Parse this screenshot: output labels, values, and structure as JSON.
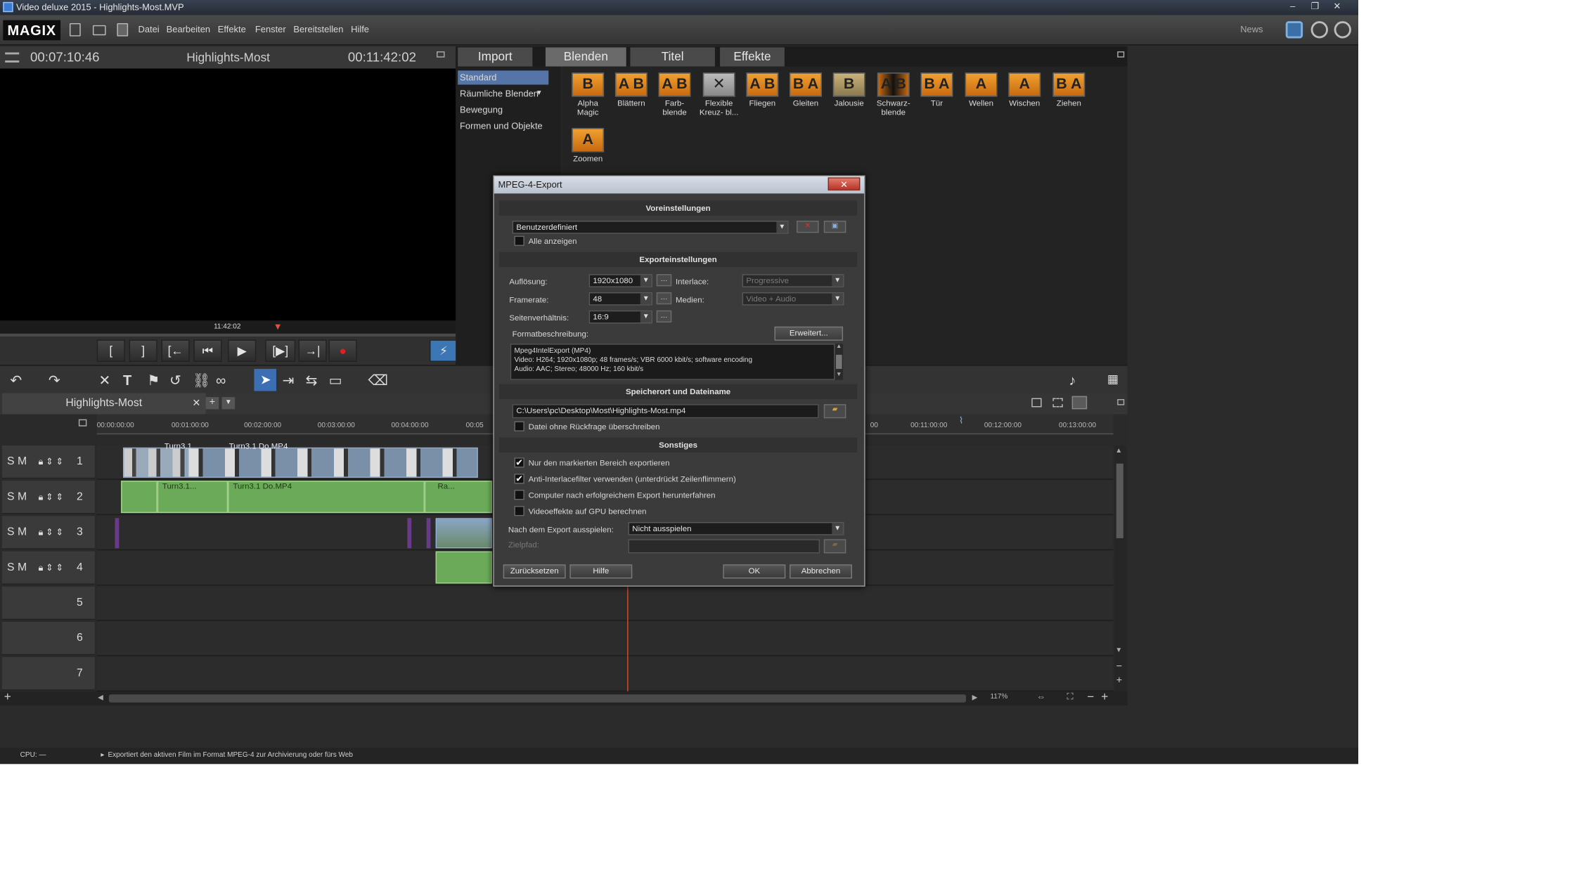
{
  "window": {
    "title": "Video deluxe 2015 - Highlights-Most.MVP",
    "controls": [
      "–",
      "❐",
      "✕"
    ]
  },
  "menubar": {
    "logo": "MAGIX",
    "menus": [
      "Datei",
      "Bearbeiten",
      "Effekte",
      "Fenster",
      "Bereitstellen",
      "Hilfe"
    ],
    "news": "News"
  },
  "preview": {
    "time_left": "00:07:10:46",
    "title": "Highlights-Most",
    "time_right": "00:11:42:02",
    "scrub_time": "11:42:02",
    "transport": [
      "[",
      "]",
      "[←",
      "⏮",
      "▶",
      "[▶]",
      "→|",
      "●",
      "⚡"
    ]
  },
  "mediapool": {
    "tabs": [
      "Import",
      "Blenden",
      "Titel",
      "Effekte"
    ],
    "active_tab": "Blenden",
    "categories": [
      "Standard",
      "Räumliche Blenden",
      "Bewegung",
      "Formen und Objekte"
    ],
    "selected_category": "Standard",
    "transitions": [
      {
        "letters": "B",
        "label": "Alpha Magic"
      },
      {
        "letters": "A B",
        "label": "Blättern"
      },
      {
        "letters": "A B",
        "label": "Farb- blende"
      },
      {
        "letters": "✕",
        "label": "Flexible Kreuz- bl..."
      },
      {
        "letters": "A B",
        "label": "Fliegen"
      },
      {
        "letters": "B A",
        "label": "Gleiten"
      },
      {
        "letters": "B",
        "label": "Jalousie"
      },
      {
        "letters": "A B",
        "label": "Schwarz- blende"
      },
      {
        "letters": "B A",
        "label": "Tür"
      },
      {
        "letters": "A",
        "label": "Wellen"
      },
      {
        "letters": "A",
        "label": "Wischen"
      },
      {
        "letters": "B A",
        "label": "Ziehen"
      },
      {
        "letters": "A",
        "label": "Zoomen"
      }
    ]
  },
  "timeline": {
    "project_tab": "Highlights-Most",
    "ruler": [
      "00:00:00:00",
      "00:01:00:00",
      "00:02:00:00",
      "00:03:00:00",
      "00:04:00:00",
      "00:05",
      "00",
      "00:11:00:00",
      "00:12:00:00",
      "00:13:00:00"
    ],
    "tracks": [
      "1",
      "2",
      "3",
      "4",
      "5",
      "6",
      "7"
    ],
    "track_controls": "S M",
    "clips": {
      "v1_a": "Turn3.1",
      "v1_b": "Turn3.1 Do.MP4",
      "a2_a": "Turn3.1...",
      "a2_b": "Turn3.1 Do.MP4",
      "a2_c": "Ra..."
    },
    "zoom": "117%"
  },
  "statusbar": {
    "cpu": "CPU: —",
    "message": "Exportiert den aktiven Film im Format MPEG-4 zur Archivierung oder fürs Web"
  },
  "dialog": {
    "title": "MPEG-4-Export",
    "close": "✕",
    "sections": {
      "presets": "Voreinstellungen",
      "export": "Exporteinstellungen",
      "location": "Speicherort und Dateiname",
      "misc": "Sonstiges"
    },
    "preset_value": "Benutzerdefiniert",
    "show_all": "Alle anzeigen",
    "resolution_label": "Auflösung:",
    "resolution": "1920x1080",
    "framerate_label": "Framerate:",
    "framerate": "48",
    "aspect_label": "Seitenverhältnis:",
    "aspect": "16:9",
    "interlace_label": "Interlace:",
    "interlace": "Progressive",
    "media_label": "Medien:",
    "media": "Video + Audio",
    "format_desc_label": "Formatbeschreibung:",
    "advanced": "Erweitert...",
    "format_desc": "Mpeg4IntelExport (MP4)\nVideo: H264; 1920x1080p; 48 frames/s; VBR 6000 kbit/s; software encoding\nAudio: AAC; Stereo; 48000 Hz; 160 kbit/s",
    "path": "C:\\Users\\pc\\Desktop\\Most\\Highlights-Most.mp4",
    "overwrite": "Datei ohne Rückfrage überschreiben",
    "opt1": "Nur den markierten Bereich exportieren",
    "opt2": "Anti-Interlacefilter verwenden (unterdrückt Zeilenflimmern)",
    "opt3": "Computer nach erfolgreichem Export herunterfahren",
    "opt4": "Videoeffekte auf GPU berechnen",
    "after_label": "Nach dem Export ausspielen:",
    "after_value": "Nicht ausspielen",
    "target_label": "Zielpfad:",
    "reset": "Zurücksetzen",
    "help": "Hilfe",
    "ok": "OK",
    "cancel": "Abbrechen",
    "checks": {
      "opt1": "✔",
      "opt2": "✔"
    }
  }
}
